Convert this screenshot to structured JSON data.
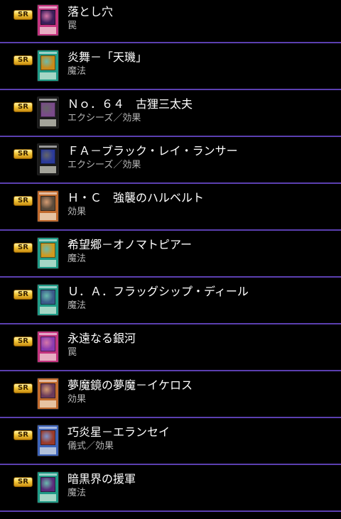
{
  "colors": {
    "background": "#000000",
    "divider": "#5b3fb0",
    "badge_gold": "#f4c93a",
    "trap_card": "#c2337e",
    "spell_card": "#1f9a86",
    "xyz_card": "#1a1a1a",
    "effect_card": "#c06a2d",
    "ritual_card": "#3d63b8"
  },
  "cards": [
    {
      "rarity": "SR",
      "name": "落とし穴",
      "type": "罠",
      "card_color": "#c2337e",
      "art_color": "#3b1d5a"
    },
    {
      "rarity": "SR",
      "name": "炎舞－「天璣」",
      "type": "魔法",
      "card_color": "#1f9a86",
      "art_color": "#c98a1a"
    },
    {
      "rarity": "SR",
      "name": "Ｎｏ．６４　古狸三太夫",
      "type": "エクシーズ／効果",
      "card_color": "#1a1a1a",
      "art_color": "#7a4a8a"
    },
    {
      "rarity": "SR",
      "name": "ＦＡ－ブラック・レイ・ランサー",
      "type": "エクシーズ／効果",
      "card_color": "#1a1a1a",
      "art_color": "#2a3a9a"
    },
    {
      "rarity": "SR",
      "name": "Ｈ・Ｃ　強襲のハルベルト",
      "type": "効果",
      "card_color": "#c06a2d",
      "art_color": "#5a4a3a"
    },
    {
      "rarity": "SR",
      "name": "希望郷－オノマトピアー",
      "type": "魔法",
      "card_color": "#1f9a86",
      "art_color": "#d09a20"
    },
    {
      "rarity": "SR",
      "name": "Ｕ．Ａ．フラッグシップ・ディール",
      "type": "魔法",
      "card_color": "#1f9a86",
      "art_color": "#3a5a8a"
    },
    {
      "rarity": "SR",
      "name": "永遠なる銀河",
      "type": "罠",
      "card_color": "#c2337e",
      "art_color": "#8a3ab0"
    },
    {
      "rarity": "SR",
      "name": "夢魔鏡の夢魔－イケロス",
      "type": "効果",
      "card_color": "#c06a2d",
      "art_color": "#6a3a5a"
    },
    {
      "rarity": "SR",
      "name": "巧炎星－エランセイ",
      "type": "儀式／効果",
      "card_color": "#3d63b8",
      "art_color": "#9a3a2a"
    },
    {
      "rarity": "SR",
      "name": "暗黒界の援軍",
      "type": "魔法",
      "card_color": "#1f9a86",
      "art_color": "#5a2a7a"
    }
  ]
}
